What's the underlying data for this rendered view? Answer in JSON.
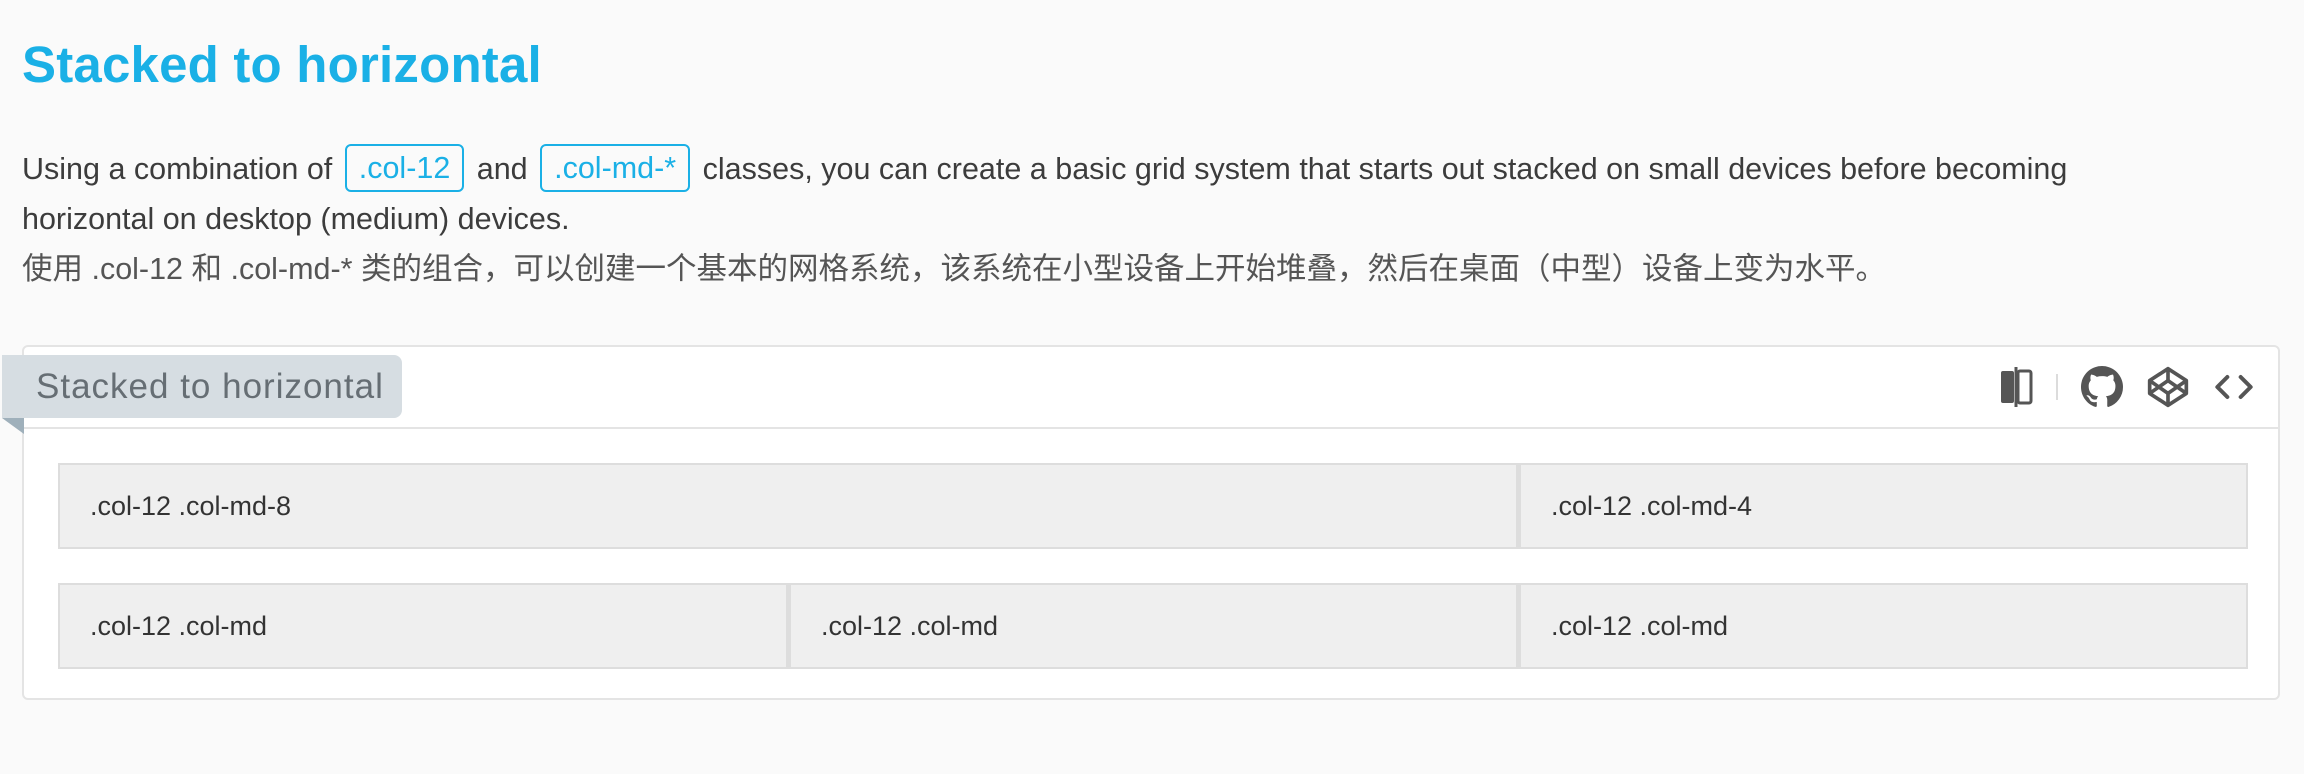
{
  "section": {
    "title": "Stacked to horizontal"
  },
  "description": {
    "part1": "Using a combination of ",
    "chip1": ".col-12",
    "part2": " and ",
    "chip2": ".col-md-*",
    "part3": " classes, you can create a basic grid system that starts out stacked on small devices before becoming",
    "line2": "horizontal on desktop (medium) devices.",
    "zh": "使用 .col-12 和 .col-md-* 类的组合，可以创建一个基本的网格系统，该系统在小型设备上开始堆叠，然后在桌面（中型）设备上变为水平。"
  },
  "demo": {
    "tag": "Stacked to horizontal",
    "tools": [
      {
        "icon": "compare-icon"
      },
      {
        "icon": "github-icon"
      },
      {
        "icon": "codepen-icon"
      },
      {
        "icon": "code-icon"
      }
    ],
    "rows": [
      {
        "cells": [
          ".col-12 .col-md-8",
          ".col-12 .col-md-4"
        ]
      },
      {
        "cells": [
          ".col-12 .col-md",
          ".col-12 .col-md",
          ".col-12 .col-md"
        ]
      }
    ]
  },
  "colors": {
    "accent": "#1ab0e6",
    "tag_bg": "#d6dde2",
    "cell_bg": "#efefef"
  }
}
